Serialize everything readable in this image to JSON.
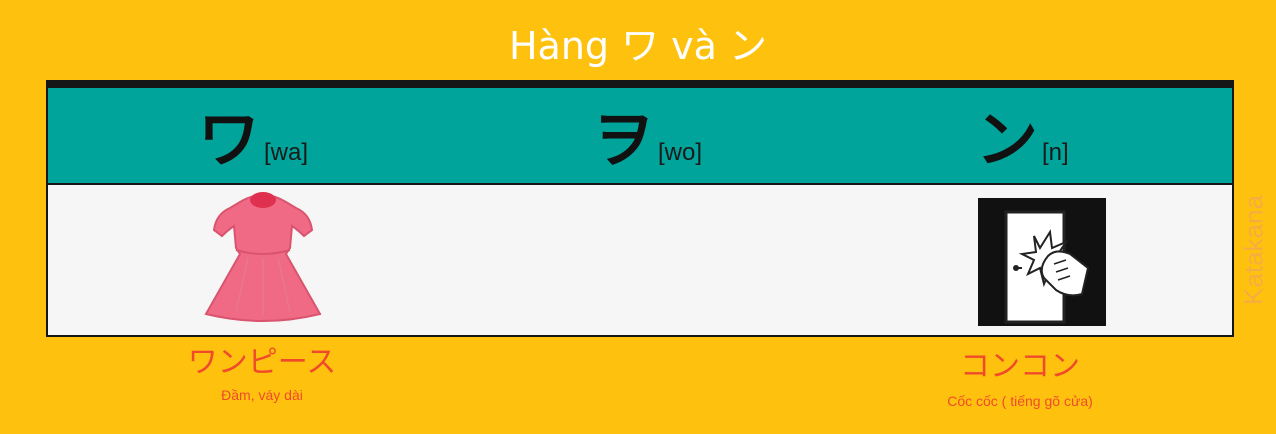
{
  "title": "Hàng ワ và ン",
  "side_label": "Katakana",
  "columns": [
    {
      "kana": "ワ",
      "romaji": "[wa]"
    },
    {
      "kana": "ヲ",
      "romaji": "[wo]"
    },
    {
      "kana": "ン",
      "romaji": "[n]"
    }
  ],
  "examples": {
    "wa": {
      "word": "ワンピース",
      "meaning": "Đầm, váy dài",
      "image": "pink-dress-icon"
    },
    "n": {
      "word": "コンコン",
      "meaning": "Cốc cốc ( tiếng gõ cửa)",
      "image": "door-knock-icon"
    }
  },
  "colors": {
    "background": "#fec20e",
    "header": "#00a49a",
    "accent_text": "#f04a2b",
    "dress": "#f06a85"
  }
}
